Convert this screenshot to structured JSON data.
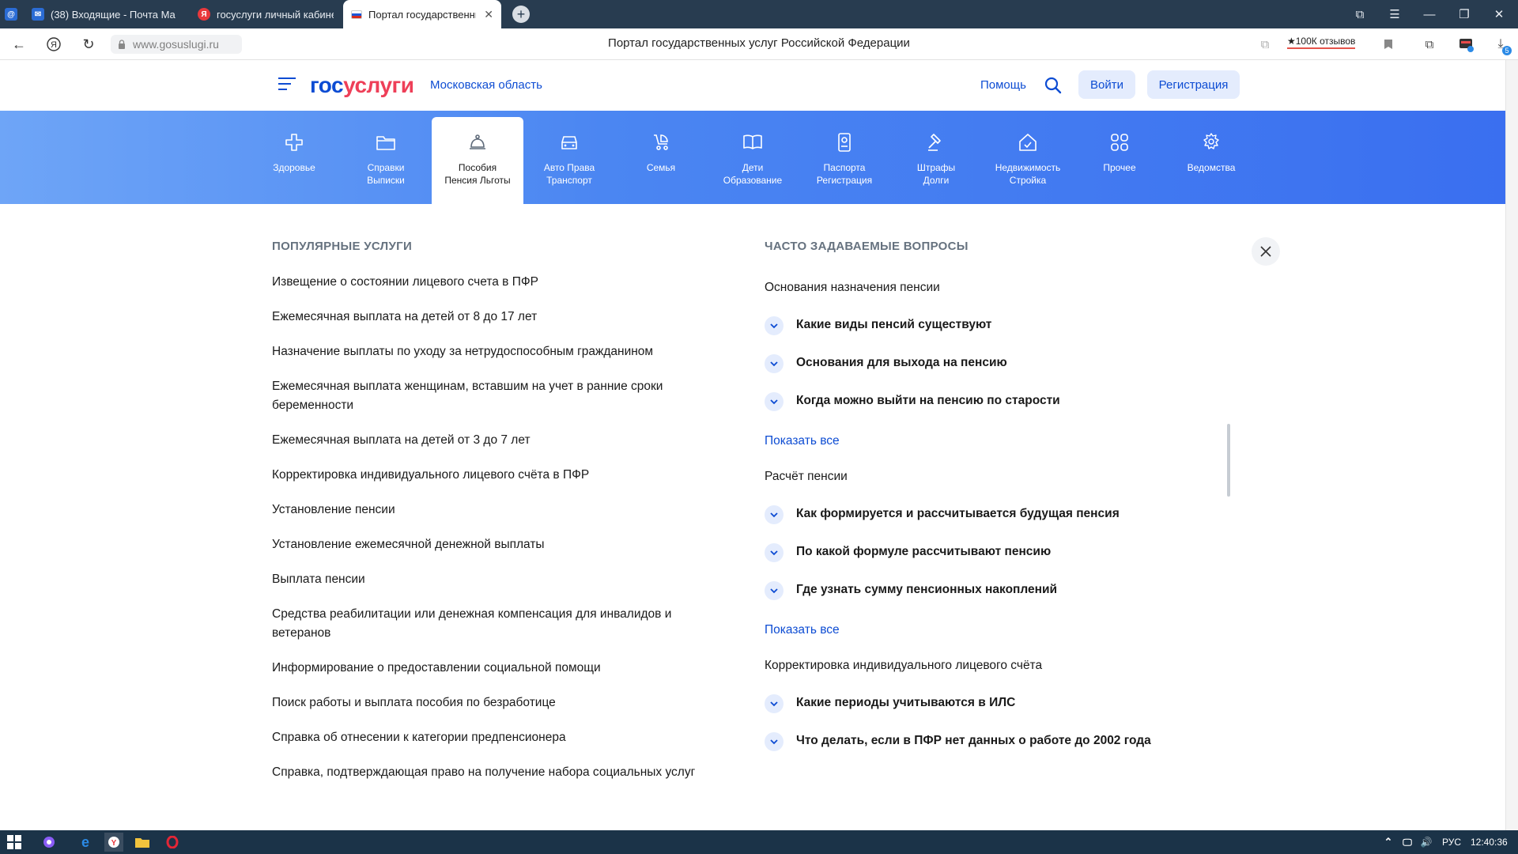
{
  "browser": {
    "tabs": [
      {
        "title": "(38) Входящие - Почта Ma",
        "fav_color": "#2b6cd4",
        "fav_glyph": "✉"
      },
      {
        "title": "госуслуги личный кабине",
        "fav_color": "#e9383c",
        "fav_glyph": "Я"
      },
      {
        "title": "Портал государственны",
        "fav_color": "#ffffff",
        "fav_glyph": ""
      }
    ],
    "new_tab_glyph": "+",
    "url": "www.gosuslugi.ru",
    "page_title": "Портал государственных услуг Российской Федерации",
    "reviews_badge": "★100К отзывов",
    "downloads_count": "5"
  },
  "header": {
    "logo_part1": "гос",
    "logo_part2": "услуги",
    "region": "Московская область",
    "help": "Помощь",
    "login": "Войти",
    "register": "Регистрация"
  },
  "categories": [
    {
      "line1": "Здоровье",
      "line2": "",
      "icon": "plus-icon"
    },
    {
      "line1": "Справки",
      "line2": "Выписки",
      "icon": "folder-icon"
    },
    {
      "line1": "Пособия",
      "line2": "Пенсия Льготы",
      "icon": "bell-icon",
      "active": true
    },
    {
      "line1": "Авто Права",
      "line2": "Транспорт",
      "icon": "car-icon"
    },
    {
      "line1": "Семья",
      "line2": "",
      "icon": "stroller-icon"
    },
    {
      "line1": "Дети",
      "line2": "Образование",
      "icon": "book-icon"
    },
    {
      "line1": "Паспорта",
      "line2": "Регистрация",
      "icon": "passport-icon"
    },
    {
      "line1": "Штрафы",
      "line2": "Долги",
      "icon": "gavel-icon"
    },
    {
      "line1": "Недвижимость",
      "line2": "Стройка",
      "icon": "house-icon"
    },
    {
      "line1": "Прочее",
      "line2": "",
      "icon": "grid-icon"
    },
    {
      "line1": "Ведомства",
      "line2": "",
      "icon": "emblem-icon"
    }
  ],
  "popular": {
    "title": "ПОПУЛЯРНЫЕ УСЛУГИ",
    "items": [
      "Извещение о состоянии лицевого счета в ПФР",
      "Ежемесячная выплата на детей от 8 до 17 лет",
      "Назначение выплаты по уходу за нетрудоспособным гражданином",
      "Ежемесячная выплата женщинам, вставшим на учет в ранние сроки беременности",
      "Ежемесячная выплата на детей от 3 до 7 лет",
      "Корректировка индивидуального лицевого счёта в ПФР",
      "Установление пенсии",
      "Установление ежемесячной денежной выплаты",
      "Выплата пенсии",
      "Средства реабилитации или денежная компенсация для инвалидов и ветеранов",
      "Информирование о предоставлении социальной помощи",
      "Поиск работы и выплата пособия по безработице",
      "Справка об отнесении к категории предпенсионера",
      "Справка, подтверждающая право на получение набора социальных услуг"
    ]
  },
  "faq": {
    "title": "ЧАСТО ЗАДАВАЕМЫЕ ВОПРОСЫ",
    "show_all": "Показать все",
    "groups": [
      {
        "name": "Основания назначения пенсии",
        "questions": [
          "Какие виды пенсий существуют",
          "Основания для выхода на пенсию",
          "Когда можно выйти на пенсию по старости"
        ]
      },
      {
        "name": "Расчёт пенсии",
        "questions": [
          "Как формируется и рассчитывается будущая пенсия",
          "По какой формуле рассчитывают пенсию",
          "Где узнать сумму пенсионных накоплений"
        ]
      },
      {
        "name": "Корректировка индивидуального лицевого счёта",
        "questions": [
          "Какие периоды учитываются в ИЛС",
          "Что делать, если в ПФР нет данных о работе до 2002 года"
        ]
      }
    ]
  },
  "taskbar": {
    "lang": "РУС",
    "time": "12:40:36"
  },
  "colors": {
    "brand_blue": "#0d4cd3",
    "brand_red": "#ee3f58",
    "category_bar": "#4b86f2"
  }
}
